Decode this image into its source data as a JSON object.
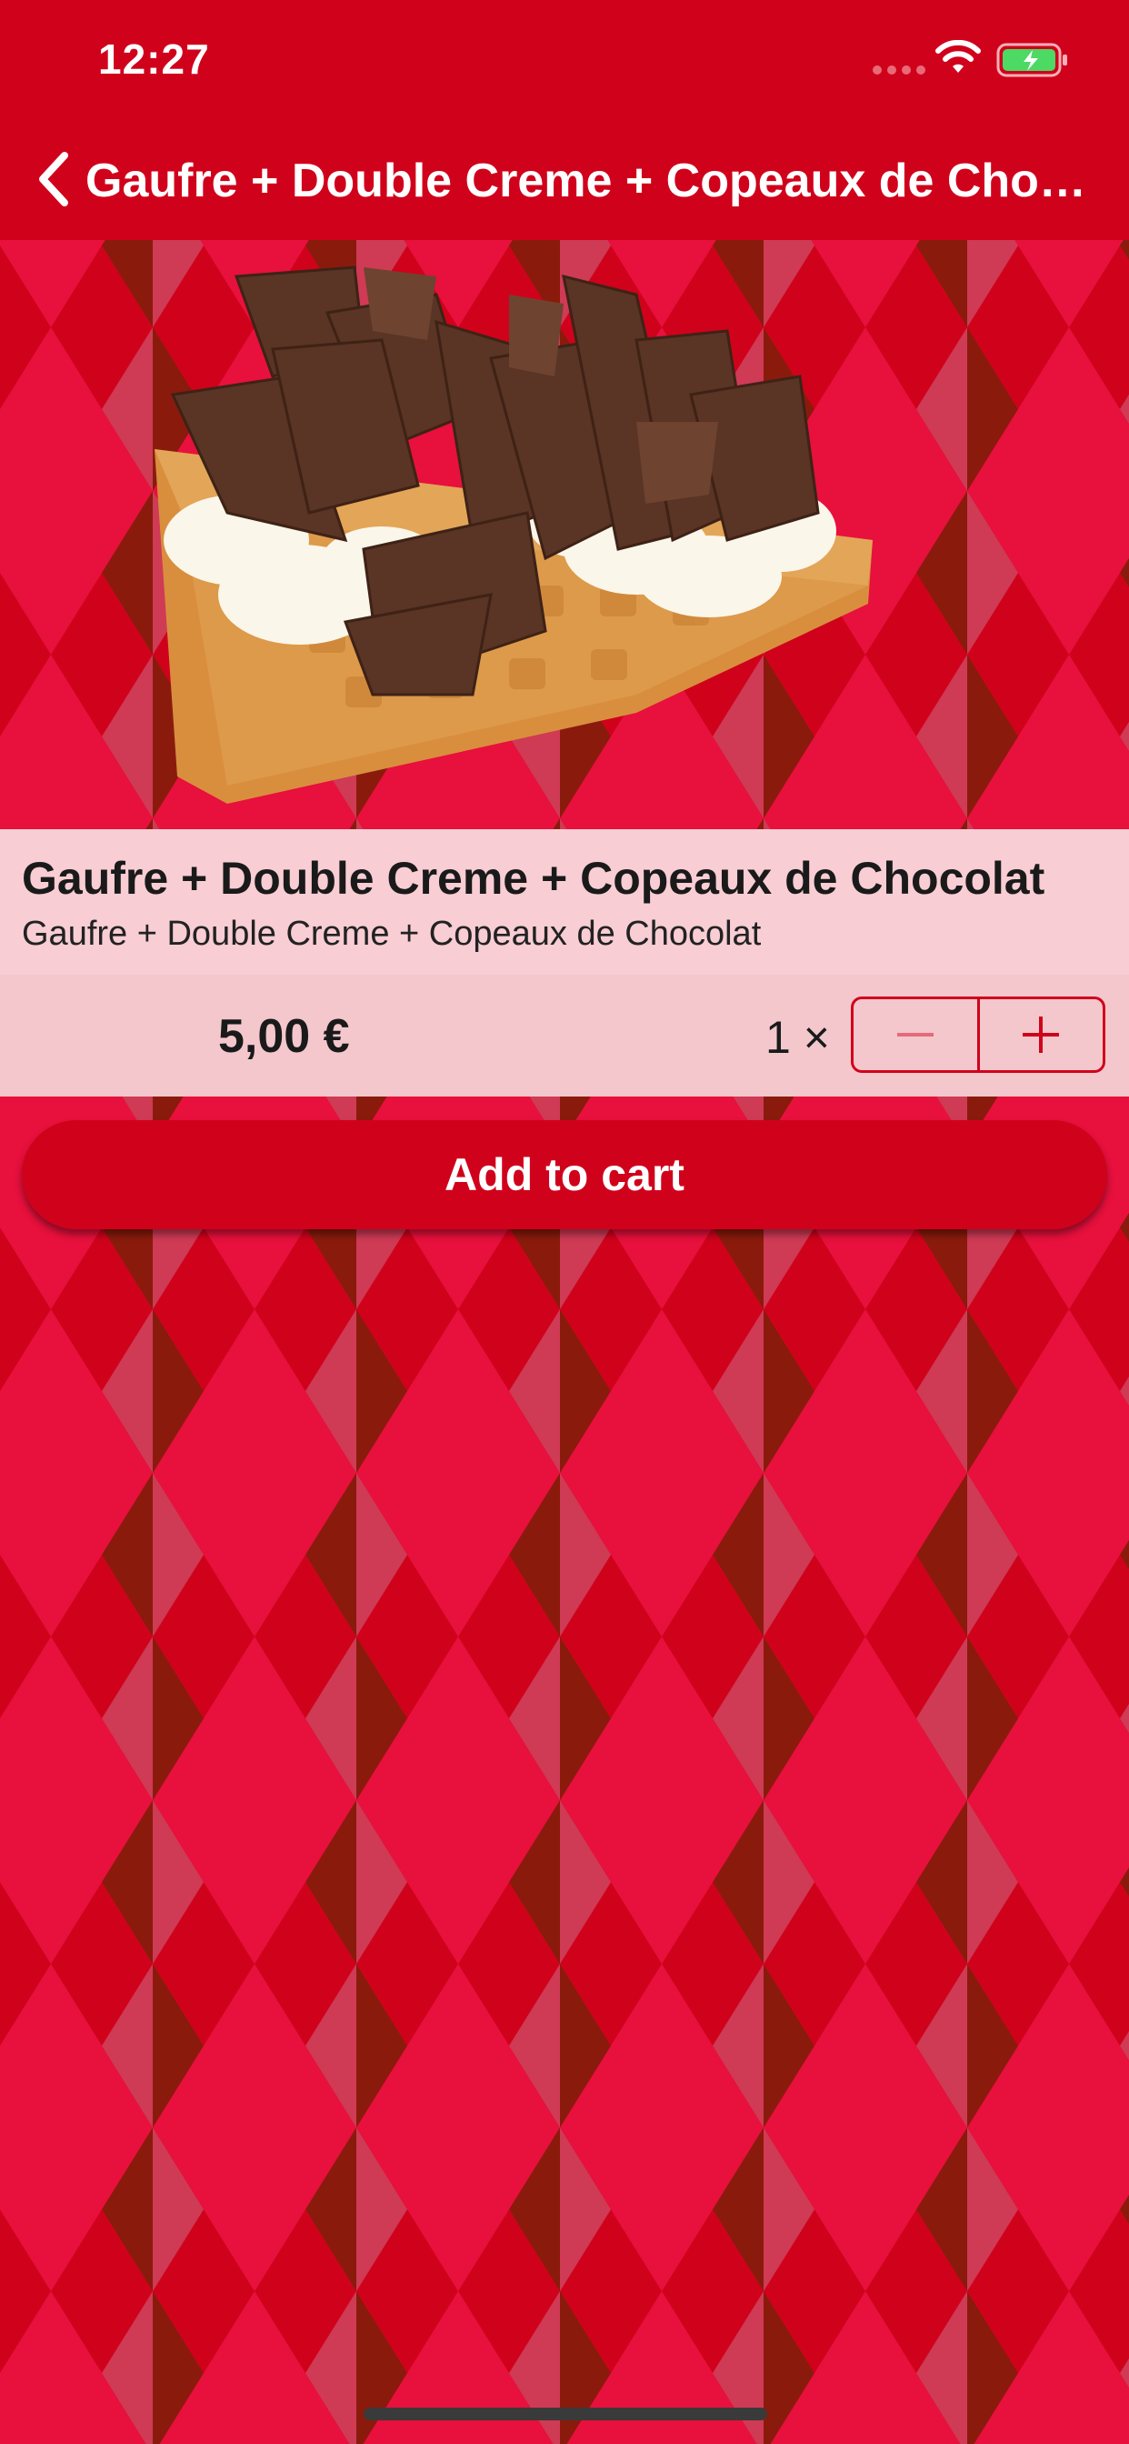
{
  "status_bar": {
    "time": "12:27"
  },
  "nav": {
    "title": "Gaufre + Double Creme + Copeaux de Chocolat"
  },
  "product": {
    "name": "Gaufre + Double Creme + Copeaux de Chocolat",
    "description": "Gaufre + Double Creme + Copeaux de Chocolat",
    "price": "5,00 €",
    "quantity_label": "1 ×"
  },
  "actions": {
    "add_to_cart": "Add to cart"
  },
  "colors": {
    "brand_red": "#d0021b",
    "panel_pink": "#f8cdd4",
    "pattern_red": "#e8103c",
    "pattern_pink": "#cf3a55",
    "pattern_brown": "#8a1b0c"
  },
  "icons": {
    "back": "chevron-left-icon",
    "minus": "minus-icon",
    "plus": "plus-icon",
    "wifi": "wifi-icon",
    "battery": "battery-charging-icon"
  }
}
